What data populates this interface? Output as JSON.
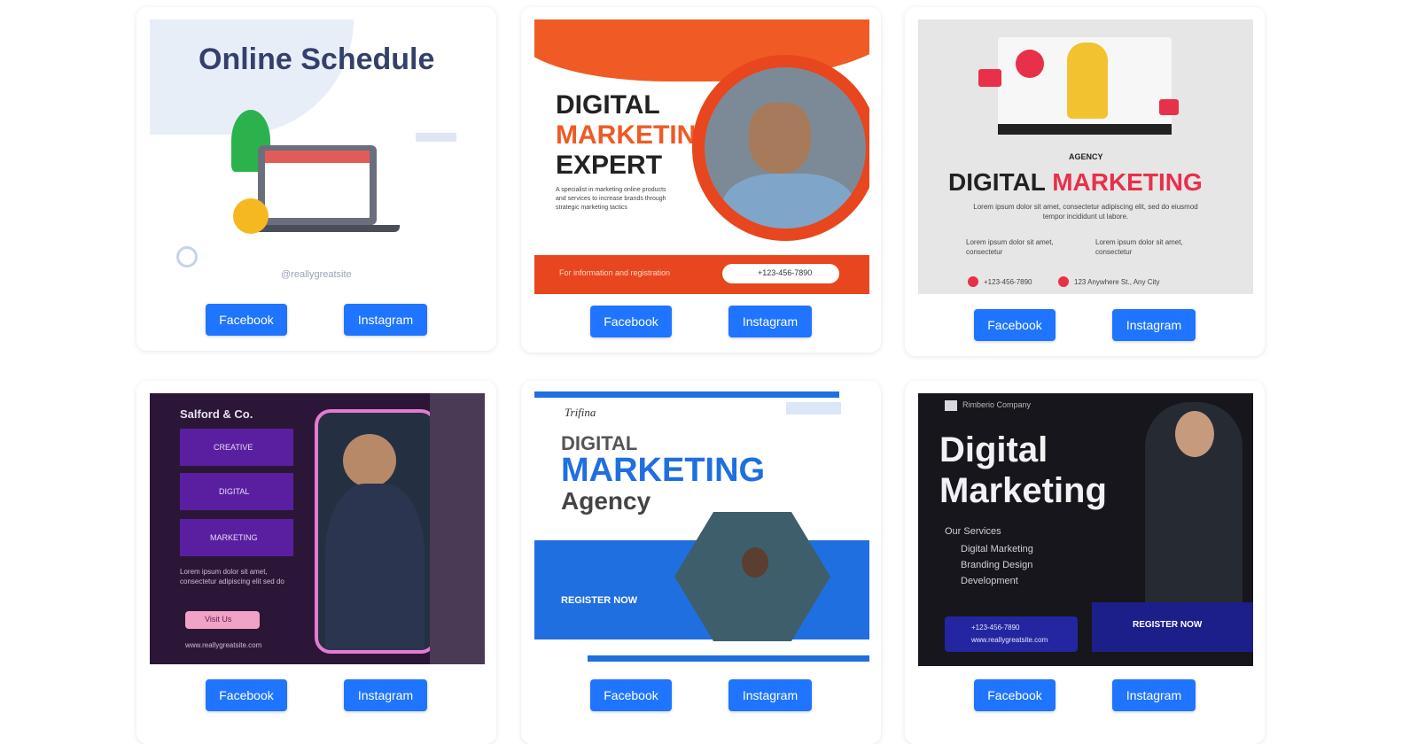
{
  "cards": [
    {
      "facebook_label": "Facebook",
      "instagram_label": "Instagram",
      "thumb": {
        "title": "Online Schedule",
        "handle": "@reallygreatsite"
      }
    },
    {
      "facebook_label": "Facebook",
      "instagram_label": "Instagram",
      "thumb": {
        "line1": "DIGITAL",
        "line2": "MARKETING",
        "line3": "EXPERT",
        "body": "A specialist in marketing online products and services to increase brands through strategic marketing tactics",
        "footer_text": "For information and registration",
        "phone": "+123-456-7890"
      }
    },
    {
      "facebook_label": "Facebook",
      "instagram_label": "Instagram",
      "thumb": {
        "kicker": "AGENCY",
        "word1": "DIGITAL",
        "word2": "MARKETING",
        "body": "Lorem ipsum dolor sit amet, consectetur adipiscing elit, sed do eiusmod tempor incididunt ut labore.",
        "bullet1": "Lorem ipsum dolor sit amet, consectetur",
        "bullet2": "Lorem ipsum dolor sit amet, consectetur",
        "phone": "+123-456-7890",
        "address": "123 Anywhere St., Any City"
      }
    },
    {
      "facebook_label": "Facebook",
      "instagram_label": "Instagram",
      "thumb": {
        "brand": "Salford & Co.",
        "tag1": "CREATIVE",
        "tag2": "DIGITAL",
        "tag3": "MARKETING",
        "body": "Lorem ipsum dolor sit amet, consectetur adipiscing elit sed do",
        "cta": "Visit Us",
        "site": "www.reallygreatsite.com"
      }
    },
    {
      "facebook_label": "Facebook",
      "instagram_label": "Instagram",
      "thumb": {
        "logo": "Trifina",
        "line1": "DIGITAL",
        "line2": "MARKETING",
        "line3": "Agency",
        "cta": "REGISTER NOW"
      }
    },
    {
      "facebook_label": "Facebook",
      "instagram_label": "Instagram",
      "thumb": {
        "brand": "Rimberio Company",
        "line1": "Digital",
        "line2": "Marketing",
        "services_title": "Our Services",
        "service1": "Digital Marketing",
        "service2": "Branding Design",
        "service3": "Development",
        "phone": "+123-456-7890",
        "site": "www.reallygreatsite.com",
        "cta": "REGISTER NOW"
      }
    }
  ]
}
